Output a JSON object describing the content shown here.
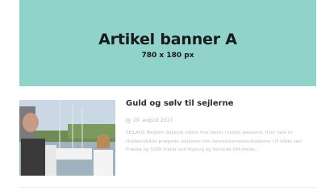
{
  "banner": {
    "title": "Artikel banner A",
    "size": "780 x 180 px",
    "color": "#8fd3cb"
  },
  "article": {
    "title": "Guld og sølv til sejlerne",
    "date": "29. august 2017",
    "date_icon": "clock-icon",
    "excerpt": "SEJLADS Medlem Sejlklub vidste fine fakter i sidste weekend, hvor hele to Hoideorsbåde prægede sejladsen om danmarksmesterskaberne i IF-både ved Præstø og 5000 meter ved Nyborg og hentede DM-meda..."
  }
}
